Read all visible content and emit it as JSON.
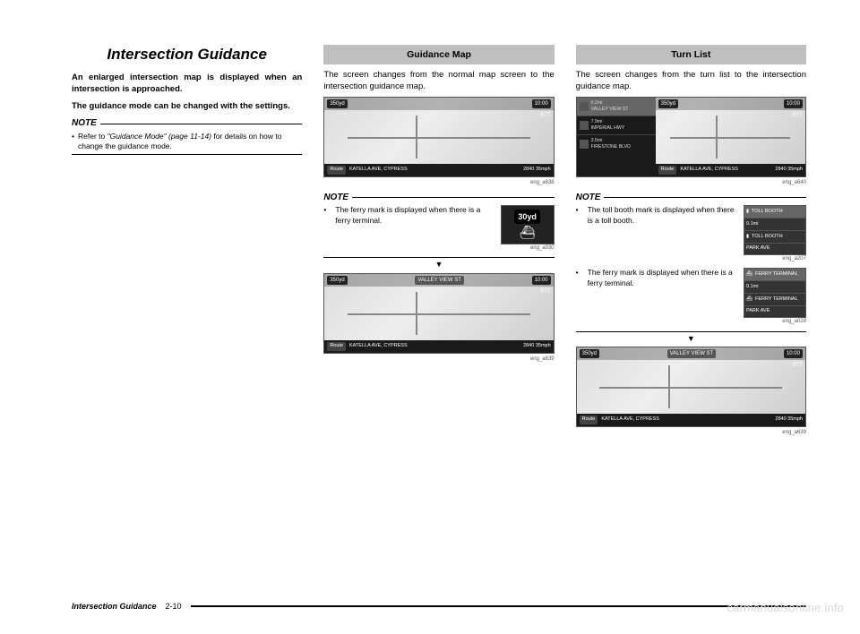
{
  "col1": {
    "title": "Intersection Guidance",
    "intro1": "An enlarged intersection map is displayed when an intersection is approached.",
    "intro2": "The guidance mode can be changed with the settings.",
    "note_label": "NOTE",
    "note_pre": "Refer to ",
    "note_ref": "\"Guidance Mode\" (page 11-14)",
    "note_post": " for details on how to change the guidance mode."
  },
  "col2": {
    "header": "Guidance Map",
    "body": "The screen changes from the normal map screen to the intersection guidance map.",
    "ss1": {
      "dist": "350yd",
      "time": "10:00",
      "rtt": "RTT",
      "route_btn": "Route",
      "street": "KATELLA AVE, CYPRESS",
      "right": "2840 35mph",
      "caption": "eng_a638"
    },
    "note_label": "NOTE",
    "note_text": "The ferry mark is displayed when there is a ferry terminal.",
    "badge": {
      "dist": "30yd",
      "caption": "eng_a030"
    },
    "arrow": "▼",
    "ss2": {
      "dist": "350yd",
      "banner": "VALLEY VIEW ST",
      "time": "10:00",
      "rtt": "RTT",
      "route_btn": "Route",
      "street": "KATELLA AVE, CYPRESS",
      "right": "2840 35mph",
      "caption": "eng_a639"
    }
  },
  "col3": {
    "header": "Turn List",
    "body": "The screen changes from the turn list to the intersection guidance map.",
    "ss1": {
      "dist": "350yd",
      "time": "10:00",
      "rtt": "RTT",
      "turns": [
        {
          "d": "0.2mi",
          "name": "VALLEY VIEW ST",
          "hl": true
        },
        {
          "d": "7.9mi",
          "name": "IMPERIAL HWY"
        },
        {
          "d": "3.5mi",
          "name": "FIRESTONE BLVD"
        }
      ],
      "route_btn": "Route",
      "street": "KATELLA AVE, CYPRESS",
      "right": "2840 35mph",
      "caption": "eng_a640"
    },
    "note_label": "NOTE",
    "note1_text": "The toll booth mark is displayed when there is a toll booth.",
    "note1_panel": {
      "rows": [
        "TOLL BOOTH",
        "0.1mi",
        "TOLL BOOTH",
        "PARK AVE"
      ],
      "caption": "eng_a207"
    },
    "note2_text": "The ferry mark is displayed when there is a ferry terminal.",
    "note2_panel": {
      "rows": [
        "FERRY TERMINAL",
        "0.1mi",
        "FERRY TERMINAL",
        "PARK AVE"
      ],
      "caption": "eng_a029"
    },
    "arrow": "▼",
    "ss2": {
      "dist": "350yd",
      "banner": "VALLEY VIEW ST",
      "time": "10:00",
      "rtt": "RTT",
      "route_btn": "Route",
      "street": "KATELLA AVE, CYPRESS",
      "right": "2840 35mph",
      "caption": "eng_a639"
    }
  },
  "footer": {
    "title": "Intersection Guidance",
    "page": "2-10"
  },
  "watermark": "carmanualsonline.info"
}
